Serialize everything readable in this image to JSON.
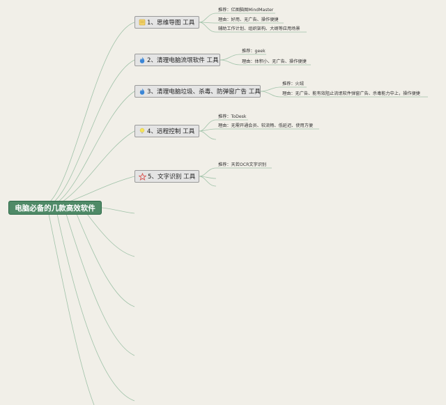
{
  "root": {
    "label": "电脑必备的几款高效软件"
  },
  "topics": [
    {
      "label": "1、思维导图 工具",
      "icon": "notepad-icon",
      "leaves": [
        "推荐：亿图脑图MindMaster",
        "理由：好用、无广告、操作便捷",
        "辅助工作计划、组织架构、大纲等应用场景"
      ]
    },
    {
      "label": "2、清理电脑流氓软件 工具",
      "icon": "flame-icon",
      "leaves": [
        "推荐：geek",
        "理由：体积小、无广告、操作便捷"
      ]
    },
    {
      "label": "3、清理电脑垃圾、杀毒、防弹窗广告 工具",
      "icon": "flame-icon",
      "leaves": [
        "推荐：火绒",
        "理由：无广告、能有效阻止流氓软件弹窗广告、杀毒能力中上，操作便捷"
      ]
    },
    {
      "label": "4、远程控制 工具",
      "icon": "light-bulb-icon",
      "leaves": [
        "推荐：ToDesk",
        "理由：无需开通会员、较流畅、低延迟、使用方便"
      ]
    },
    {
      "label": "5、文字识别 工具",
      "icon": "star-icon",
      "leaves": [
        "推荐：天若OCR文字识别"
      ]
    }
  ],
  "colors": {
    "root_fill": "#4f8a67",
    "edge": "#9fc2a8",
    "topic_fill": "#e4e4e4",
    "background": "#f1efe8"
  }
}
